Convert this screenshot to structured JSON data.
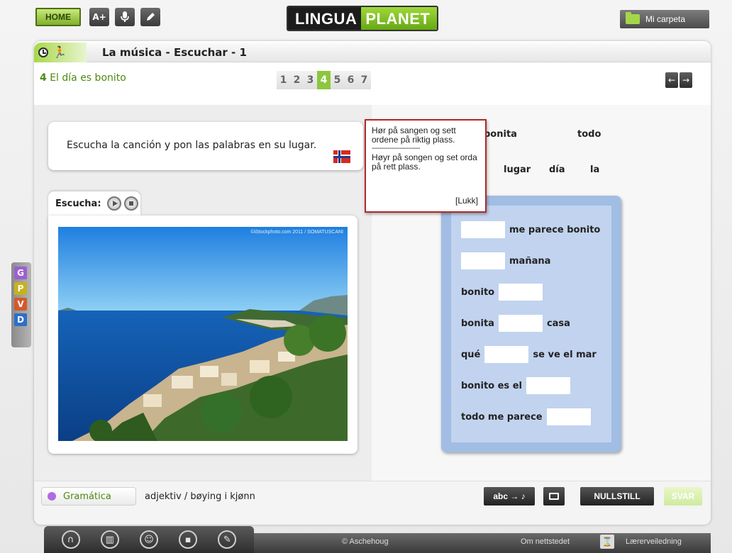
{
  "topbar": {
    "home_label": "HOME",
    "font_label": "A+",
    "mic_icon": "microphone-icon",
    "pen_icon": "pencil-icon",
    "logo_left": "LINGUA",
    "logo_right": "PLANET",
    "folder_label": "Mi carpeta"
  },
  "lesson": {
    "title": "La música - Escuchar - 1",
    "task_number": "4",
    "task_title": "El día es bonito",
    "pages": [
      "1",
      "2",
      "3",
      "4",
      "5",
      "6",
      "7"
    ],
    "active_page": "4",
    "prev_arrow": "←",
    "next_arrow": "→"
  },
  "instruction": {
    "text": "Escucha la canción y pon las palabras en su lugar."
  },
  "listen": {
    "label": "Escucha:"
  },
  "photo": {
    "credit": "©iStockphoto.com 2011 / SOMATUSCANI"
  },
  "popup": {
    "bokmal": "Hør på sangen og sett ordene på riktig plass.",
    "separator": "------------------------",
    "nynorsk": "Høyr på songen og set orda på rett plass.",
    "close": "[Lukk]"
  },
  "word_bank": {
    "w1": "bonita",
    "w2": "todo",
    "w3": "lugar",
    "w4": "día",
    "w5": "la"
  },
  "exercise": {
    "row1_after": "me parece bonito",
    "row2_after": "mañana",
    "row3_before": "bonito",
    "row4_before": "bonita",
    "row4_after": "casa",
    "row5_before": "qué",
    "row5_after": "se ve el mar",
    "row6_before": "bonito es el",
    "row7_before": "todo me parece"
  },
  "bottom": {
    "grammar_tab": "Gramática",
    "grammar_desc": "adjektiv / bøying i kjønn",
    "tts_label": "abc → ♪",
    "reset_label": "NULLSTILL",
    "answer_label": "SVAR"
  },
  "side_letters": [
    "G",
    "P",
    "V",
    "D"
  ],
  "side_colors": [
    "#9c5fd0",
    "#c7b21d",
    "#d45a2a",
    "#2e6fc7"
  ],
  "footer": {
    "copyright": "© Aschehoug",
    "about": "Om nettstedet",
    "teacher": "Lærerveiledning"
  },
  "colors": {
    "accent_green": "#8dc63f",
    "exercise_blue": "#a2bde3",
    "popup_border": "#b02a2a"
  }
}
